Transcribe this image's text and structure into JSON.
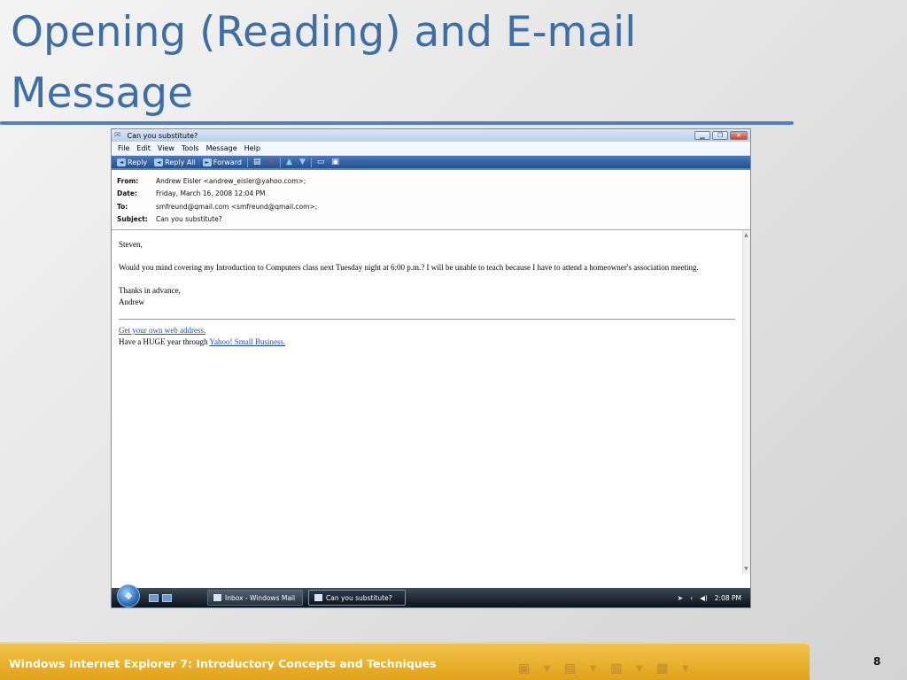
{
  "slide": {
    "title": "Opening (Reading) and E-mail Message",
    "footer": "Windows Internet Explorer 7: Introductory Concepts and Techniques",
    "page_number": "8"
  },
  "window": {
    "title": "Can you substitute?",
    "menu": [
      "File",
      "Edit",
      "View",
      "Tools",
      "Message",
      "Help"
    ],
    "toolbar": {
      "reply": "Reply",
      "reply_all": "Reply All",
      "forward": "Forward"
    }
  },
  "headers": {
    "from_label": "From:",
    "from": "Andrew Eisler <andrew_eisler@yahoo.com>;",
    "date_label": "Date:",
    "date": "Friday, March 16, 2008 12:04 PM",
    "to_label": "To:",
    "to": "smfreund@qmail.com <smfreund@qmail.com>;",
    "subject_label": "Subject:",
    "subject": "Can you substitute?"
  },
  "message": {
    "greeting": "Steven,",
    "body": "Would you mind covering my Introduction to Computers class next Tuesday night at 6:00 p.m.?  I will be unable to teach because I have to attend a homeowner's association meeting.",
    "closing": "Thanks in advance,",
    "signature": "Andrew",
    "ad_link": "Get your own web address.",
    "ad_prefix": "Have a HUGE year through ",
    "ad_link2": "Yahoo! Small Business."
  },
  "taskbar": {
    "task1": "Inbox - Windows Mail",
    "task2": "Can you substitute?",
    "time": "2:08 PM"
  }
}
